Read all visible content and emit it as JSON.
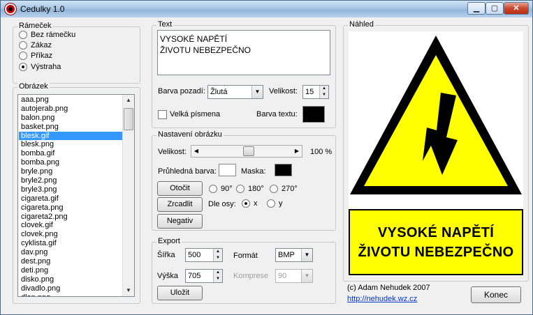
{
  "window": {
    "title": "Cedulky 1.0",
    "min": "▁",
    "max": "▢",
    "close": "✕"
  },
  "ramecek": {
    "legend": "Rámeček",
    "options": [
      {
        "label": "Bez rámečku",
        "checked": false
      },
      {
        "label": "Zákaz",
        "checked": false
      },
      {
        "label": "Příkaz",
        "checked": false
      },
      {
        "label": "Výstraha",
        "checked": true
      }
    ]
  },
  "obrazek": {
    "legend": "Obrázek",
    "items": [
      "aaa.png",
      "autojerab.png",
      "balon.png",
      "basket.png",
      "blesk.gif",
      "blesk.png",
      "bomba.gif",
      "bomba.png",
      "bryle.png",
      "bryle2.png",
      "bryle3.png",
      "cigareta.gif",
      "cigareta.png",
      "cigareta2.png",
      "clovek.gif",
      "clovek.png",
      "cyklista.gif",
      "dav.png",
      "dest.png",
      "deti.png",
      "disko.png",
      "divadlo.png",
      "dlan.png"
    ],
    "selected": "blesk.gif"
  },
  "text": {
    "legend": "Text",
    "content": "VYSOKÉ NAPĚTÍ\nŽIVOTU NEBEZPEČNO",
    "bg_label": "Barva pozadí:",
    "bg_value": "Žlutá",
    "size_label": "Velikost:",
    "size_value": "15",
    "caps_label": "Velká písmena",
    "color_label": "Barva textu:",
    "text_color": "#000000"
  },
  "image_settings": {
    "legend": "Nastavení obrázku",
    "size_label": "Velikost:",
    "size_value": "100 %",
    "size_fraction": 0.52,
    "transparent_label": "Průhledná barva:",
    "transparent_color": "#ffffff",
    "mask_label": "Maska:",
    "mask_color": "#000000",
    "rotate_button": "Otočit",
    "rotate_options": [
      {
        "label": "90°",
        "checked": false
      },
      {
        "label": "180°",
        "checked": false
      },
      {
        "label": "270°",
        "checked": false
      }
    ],
    "mirror_button": "Zrcadlit",
    "axis_label": "Dle osy:",
    "axis_options": [
      {
        "label": "x",
        "checked": true
      },
      {
        "label": "y",
        "checked": false
      }
    ],
    "negative_button": "Negativ"
  },
  "export": {
    "legend": "Export",
    "width_label": "Šířka",
    "width_value": "500",
    "height_label": "Výška",
    "height_value": "705",
    "format_label": "Formát",
    "format_value": "BMP",
    "compression_label": "Komprese",
    "compression_value": "90",
    "save_button": "Uložit"
  },
  "preview": {
    "legend": "Náhled",
    "line1": "VYSOKÉ NAPĚTÍ",
    "line2": "ŽIVOTU NEBEZPEČNO",
    "sign_color": "#ffff00"
  },
  "footer": {
    "copyright": "(c) Adam Nehudek 2007",
    "url": "http://nehudek.wz.cz",
    "close_button": "Konec"
  }
}
